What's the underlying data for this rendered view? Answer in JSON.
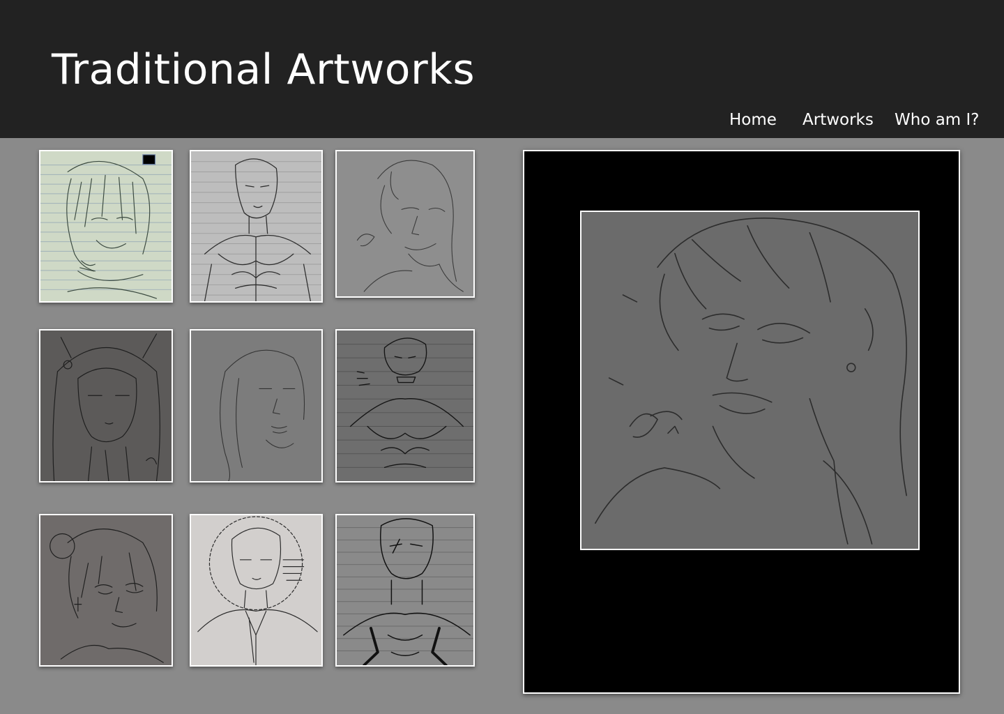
{
  "header": {
    "title": "Traditional Artworks",
    "background": "#222222"
  },
  "nav": {
    "items": [
      {
        "label": "Home"
      },
      {
        "label": "Artworks"
      },
      {
        "label": "Who am I?"
      }
    ]
  },
  "gallery": {
    "thumbnails": [
      {
        "subject": "ink sketch of long-haired character with facial scars on lined paper",
        "paper": "#cfd9c6"
      },
      {
        "subject": "ink sketch of muscular man with scars on lined paper",
        "paper": "#bdbdbd"
      },
      {
        "subject": "pencil sketch of woman with wavy hair, signed",
        "paper": "#8e8e8e"
      },
      {
        "subject": "pencil sketch of hooded figure with skull badge",
        "paper": "#5c5a59"
      },
      {
        "subject": "pencil sketch of long-haired woman",
        "paper": "#7c7c7c"
      },
      {
        "subject": "ink sketch of muscular figure with choker and handwritten text",
        "paper": "#6e6e6e"
      },
      {
        "subject": "pencil sketch of girl with hair bun and tear",
        "paper": "#6f6b6a"
      },
      {
        "subject": "ink sketch of man with barbed-wire halo and handwritten note",
        "paper": "#d2cfcd"
      },
      {
        "subject": "ink sketch of man with face markings on lined paper",
        "paper": "#8a8a8a"
      }
    ]
  },
  "viewer": {
    "selected_index": 2,
    "subject": "enlarged pencil sketch of woman with wavy hair, earring and signature",
    "paper": "#6b6b6b"
  },
  "colors": {
    "page_background": "#8a8a8a",
    "viewer_background": "#000000",
    "frame_border": "#ffffff",
    "header_text": "#ffffff"
  }
}
